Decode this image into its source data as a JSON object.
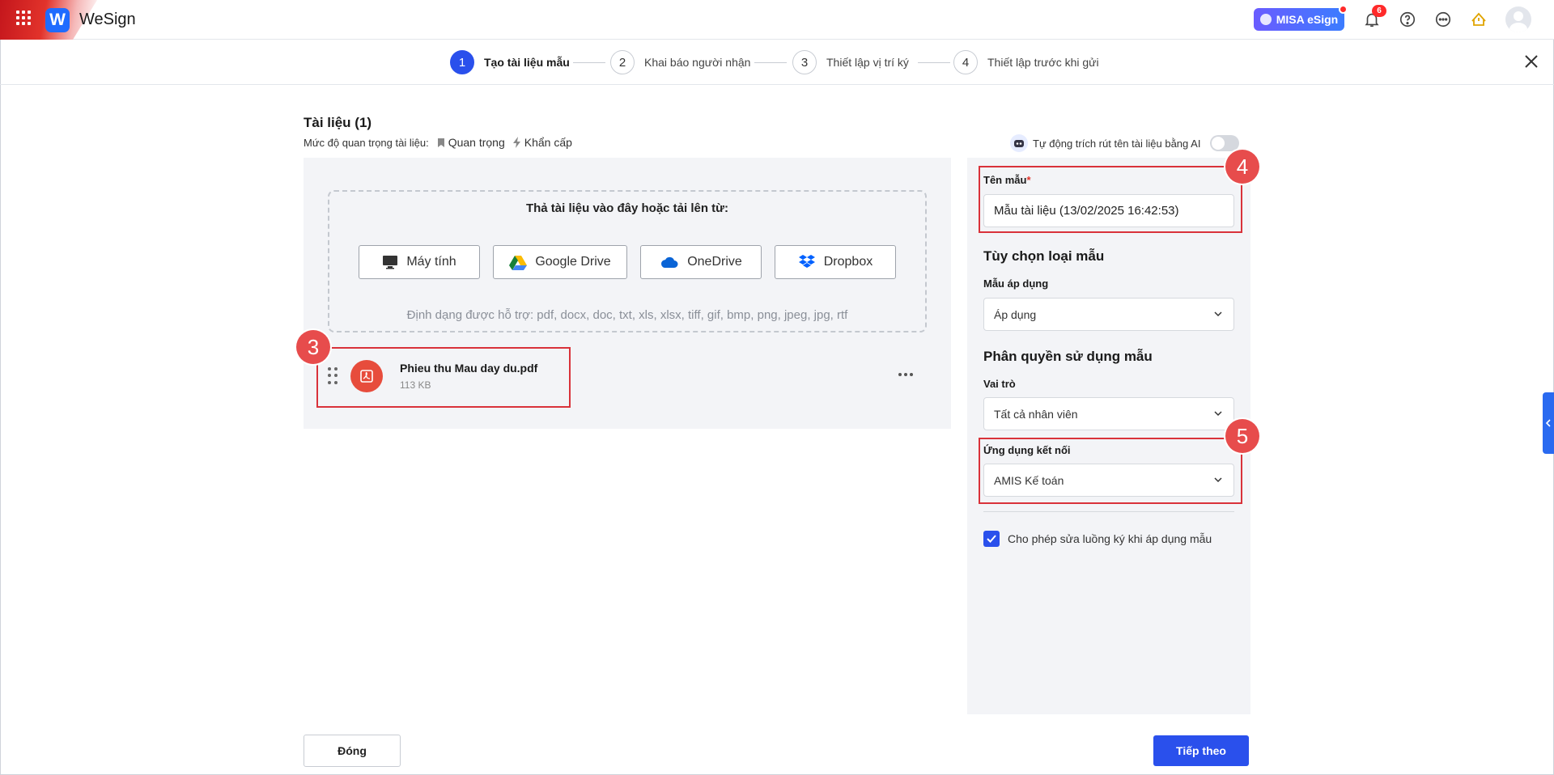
{
  "header": {
    "brand": "WeSign",
    "misa_badge": "MISA eSign",
    "notification_count": "6",
    "icons": [
      "apps-grid-icon",
      "bell-icon",
      "help-icon",
      "more-icon",
      "announcement-icon"
    ]
  },
  "stepper": {
    "steps": [
      {
        "num": "1",
        "label": "Tạo tài liệu mẫu"
      },
      {
        "num": "2",
        "label": "Khai báo người nhận"
      },
      {
        "num": "3",
        "label": "Thiết lập vị trí ký"
      },
      {
        "num": "4",
        "label": "Thiết lập trước khi gửi"
      }
    ]
  },
  "documents": {
    "title": "Tài liệu (1)",
    "priority_label": "Mức độ quan trọng tài liệu:",
    "priority_important": "Quan trọng",
    "priority_urgent": "Khẩn cấp",
    "ai_extract_label": "Tự động trích rút tên tài liệu bằng AI",
    "dropzone_title": "Thả tài liệu vào đây hoặc tải lên từ:",
    "sources": [
      "Máy tính",
      "Google Drive",
      "OneDrive",
      "Dropbox"
    ],
    "formats": "Định dạng được hỗ trợ: pdf, docx, doc, txt, xls, xlsx, tiff, gif, bmp, png, jpeg, jpg, rtf",
    "file": {
      "name": "Phieu thu Mau day du.pdf",
      "size": "113 KB"
    }
  },
  "template_panel": {
    "name_label": "Tên mẫu",
    "name_required": "*",
    "name_value": "Mẫu tài liệu (13/02/2025 16:42:53)",
    "type_section": "Tùy chọn loại mẫu",
    "apply_label": "Mẫu áp dụng",
    "apply_value": "Áp dụng",
    "permission_section": "Phân quyền sử dụng mẫu",
    "role_label": "Vai trò",
    "role_value": "Tất cả nhân viên",
    "app_label": "Ứng dụng kết nối",
    "app_value": "AMIS Kế toán",
    "allow_edit_label": "Cho phép sửa luồng ký khi áp dụng mẫu"
  },
  "annotations": [
    "3",
    "4",
    "5"
  ],
  "footer": {
    "close": "Đóng",
    "next": "Tiếp theo"
  },
  "colors": {
    "primary": "#2a50ec",
    "annotation": "#e74c4c",
    "panel_bg": "#f3f4f7"
  }
}
